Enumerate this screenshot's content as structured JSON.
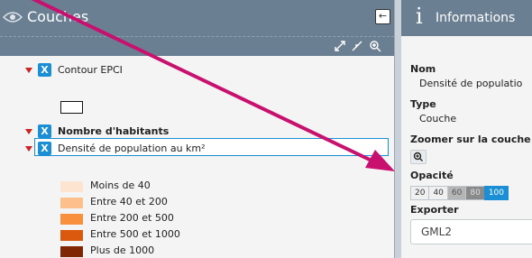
{
  "layers_panel": {
    "title": "Couches",
    "collapse_icon": "arrow-left-icon",
    "toolbar_icons": [
      "expand-icon",
      "collapse-arrows-icon",
      "zoom-icon"
    ],
    "layers": [
      {
        "name": "Contour EPCI",
        "checked": true,
        "expanded": true,
        "bold": false
      },
      {
        "name": "Nombre d'habitants",
        "checked": true,
        "expanded": true,
        "bold": true
      },
      {
        "name": "Densité de population au km²",
        "checked": true,
        "expanded": true,
        "bold": false,
        "selected": true
      }
    ],
    "legend": [
      {
        "label": "Moins de 40",
        "color": "#fde4d0"
      },
      {
        "label": "Entre 40 et 200",
        "color": "#fbc08c"
      },
      {
        "label": "Entre 200 et 500",
        "color": "#f7913e"
      },
      {
        "label": "Entre 500 et 1000",
        "color": "#d95a0e"
      },
      {
        "label": "Plus de 1000",
        "color": "#7f2704"
      }
    ]
  },
  "info_panel": {
    "title": "Informations",
    "nom_label": "Nom",
    "nom_value": "Densité de populatio",
    "type_label": "Type",
    "type_value": "Couche",
    "zoom_label": "Zoomer sur la couche",
    "opacity_label": "Opacité",
    "opacity_options": [
      "20",
      "40",
      "60",
      "80",
      "100"
    ],
    "opacity_selected": "100",
    "export_label": "Exporter",
    "export_value": "GML2"
  },
  "colors": {
    "header": "#6b7f92",
    "accent": "#1a8fd6",
    "arrow": "#c8106e"
  }
}
